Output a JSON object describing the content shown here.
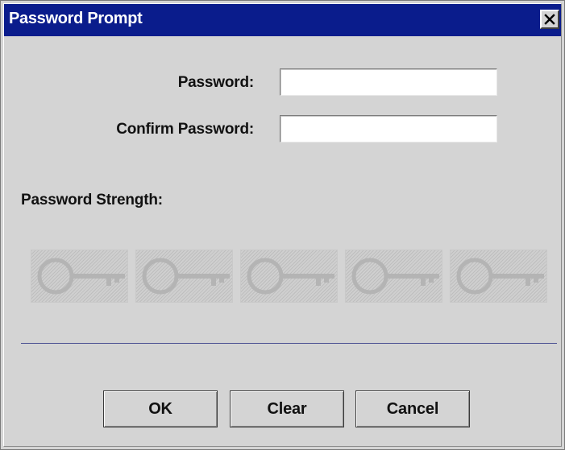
{
  "window": {
    "title": "Password Prompt",
    "close_icon": "close-x-icon"
  },
  "form": {
    "password_label": "Password:",
    "password_value": "",
    "confirm_label": "Confirm Password:",
    "confirm_value": ""
  },
  "strength": {
    "label": "Password Strength:",
    "segments_total": 5,
    "segments_active": 0,
    "segment_icon": "key-icon"
  },
  "buttons": {
    "ok_label": "OK",
    "clear_label": "Clear",
    "cancel_label": "Cancel"
  },
  "colors": {
    "titlebar": "#0a1c8c",
    "dialog_background": "#d4d4d4",
    "separator": "#4a5092"
  }
}
